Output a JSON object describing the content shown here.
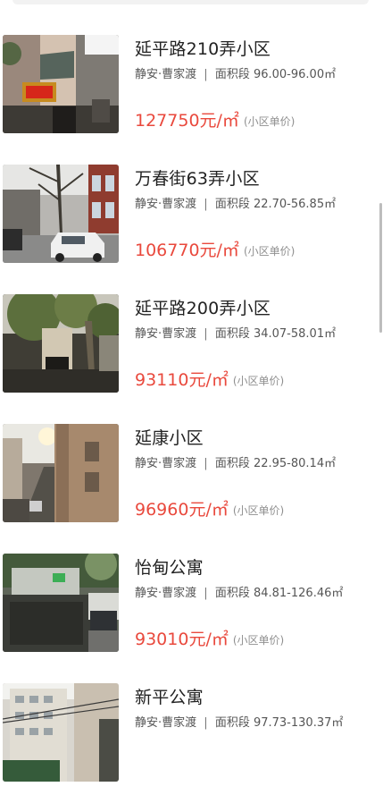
{
  "listings": [
    {
      "name": "延平路210弄小区",
      "district": "静安·曹家渡",
      "separator": "|",
      "area_label": "面积段",
      "area_range": "96.00-96.00㎡",
      "price": "127750元/㎡",
      "price_note": "(小区单价)",
      "photo": "lane-shop-photo"
    },
    {
      "name": "万春街63弄小区",
      "district": "静安·曹家渡",
      "separator": "|",
      "area_label": "面积段",
      "area_range": "22.70-56.85㎡",
      "price": "106770元/㎡",
      "price_note": "(小区单价)",
      "photo": "street-car-photo"
    },
    {
      "name": "延平路200弄小区",
      "district": "静安·曹家渡",
      "separator": "|",
      "area_label": "面积段",
      "area_range": "34.07-58.01㎡",
      "price": "93110元/㎡",
      "price_note": "(小区单价)",
      "photo": "tree-entrance-photo"
    },
    {
      "name": "延康小区",
      "district": "静安·曹家渡",
      "separator": "|",
      "area_label": "面积段",
      "area_range": "22.95-80.14㎡",
      "price": "96960元/㎡",
      "price_note": "(小区单价)",
      "photo": "narrow-lane-photo"
    },
    {
      "name": "怡甸公寓",
      "district": "静安·曹家渡",
      "separator": "|",
      "area_label": "面积段",
      "area_range": "84.81-126.46㎡",
      "price": "93010元/㎡",
      "price_note": "(小区单价)",
      "photo": "stone-sign-photo"
    },
    {
      "name": "新平公寓",
      "district": "静安·曹家渡",
      "separator": "|",
      "area_label": "面积段",
      "area_range": "97.73-130.37㎡",
      "price": "",
      "price_note": "",
      "photo": "apartment-tower-photo"
    }
  ],
  "colors": {
    "price": "#e9493d",
    "title": "#222222",
    "meta": "#555555",
    "note": "#8f8f8f",
    "scrollbar": "#bdbdbd"
  }
}
